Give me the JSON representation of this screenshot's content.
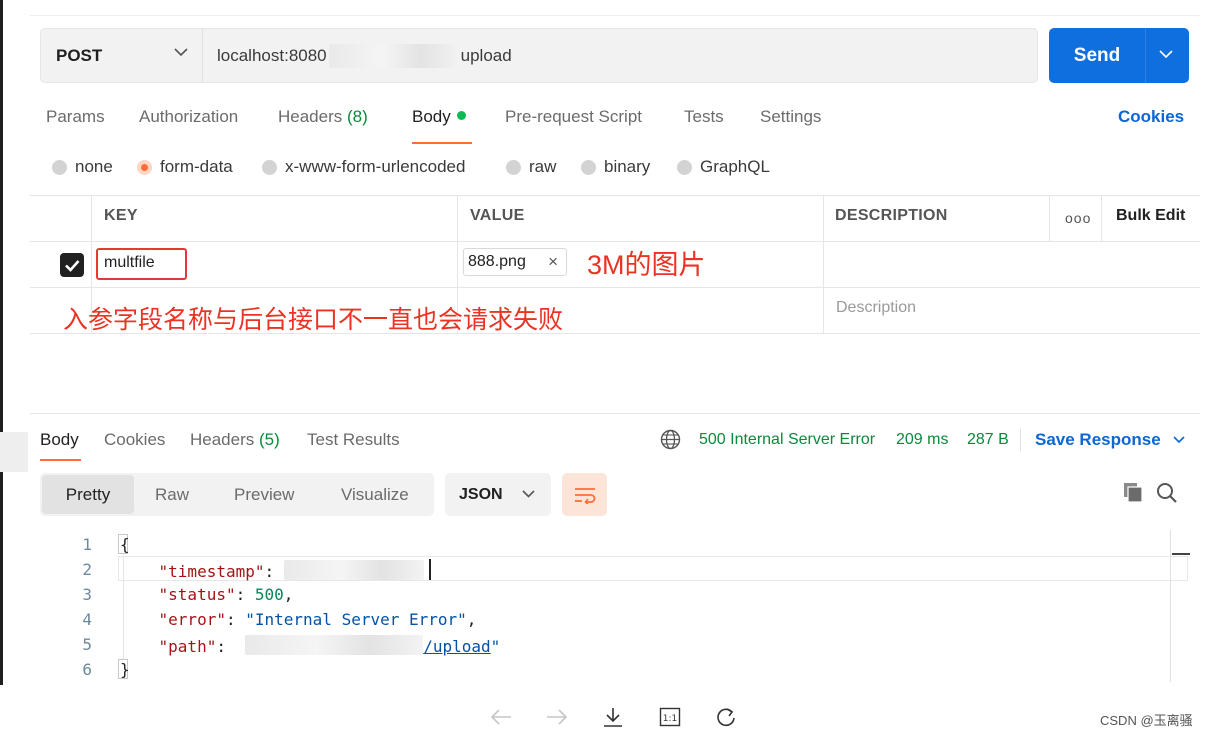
{
  "request": {
    "method": "POST",
    "url_prefix": "localhost:8080",
    "url_suffix": "upload",
    "send_label": "Send"
  },
  "tabs": [
    {
      "label": "Params"
    },
    {
      "label": "Authorization"
    },
    {
      "label": "Headers",
      "count": "(8)"
    },
    {
      "label": "Body"
    },
    {
      "label": "Pre-request Script"
    },
    {
      "label": "Tests"
    },
    {
      "label": "Settings"
    }
  ],
  "cookies_label": "Cookies",
  "body_types": [
    "none",
    "form-data",
    "x-www-form-urlencoded",
    "raw",
    "binary",
    "GraphQL"
  ],
  "table": {
    "headers": {
      "key": "KEY",
      "value": "VALUE",
      "description": "DESCRIPTION",
      "bulk_edit": "Bulk Edit",
      "more": "ooo"
    },
    "row": {
      "key": "multfile",
      "file": "888.png",
      "remove": "×"
    },
    "desc_placeholder": "Description"
  },
  "annotations": {
    "file_note": "3M的图片",
    "field_note": "入参字段名称与后台接口不一直也会请求失败"
  },
  "response": {
    "tabs": [
      {
        "label": "Body"
      },
      {
        "label": "Cookies"
      },
      {
        "label": "Headers",
        "count": "(5)"
      },
      {
        "label": "Test Results"
      }
    ],
    "status": "500 Internal Server Error",
    "time": "209 ms",
    "size": "287 B",
    "save_label": "Save Response",
    "views": [
      "Pretty",
      "Raw",
      "Preview",
      "Visualize"
    ],
    "format": "JSON",
    "lines": [
      "1",
      "2",
      "3",
      "4",
      "5",
      "6"
    ],
    "code": {
      "open": "{",
      "k_timestamp": "\"timestamp\"",
      "k_status": "\"status\"",
      "v_status": "500",
      "k_error": "\"error\"",
      "v_error": "\"Internal Server Error\"",
      "k_path": "\"path\"",
      "v_path_link": "/upload",
      "close": "}"
    }
  },
  "watermark": "CSDN @玉离骚",
  "colors": {
    "accent": "#ff6c37",
    "send": "#0f6fde",
    "link": "#0b66d6",
    "success": "#0a8a3a",
    "annotation": "#ea3323"
  }
}
